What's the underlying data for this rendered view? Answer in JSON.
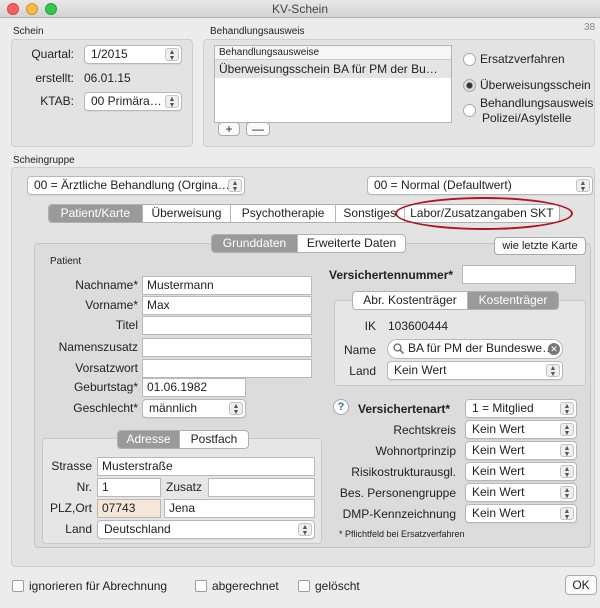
{
  "window": {
    "title": "KV-Schein"
  },
  "schein": {
    "legend": "Schein",
    "quartal_label": "Quartal:",
    "quartal_value": "1/2015",
    "erstellt_label": "erstellt:",
    "erstellt_value": "06.01.15",
    "ktab_label": "KTAB:",
    "ktab_value": "00 Primära…"
  },
  "behandlungsausweis": {
    "legend": "Behandlungsausweis",
    "list_header": "Behandlungsausweise",
    "list_item": "Überweisungsschein BA für PM der Bu…",
    "add_label": "+",
    "remove_label": "—",
    "radio_ersatz": "Ersatzverfahren",
    "radio_ueberweisung": "Überweisungsschein",
    "radio_behandlung_line1": "Behandlungsausweis",
    "radio_behandlung_line2": "Polizei/Asylstelle",
    "side_number": "38"
  },
  "scheingruppe": {
    "legend": "Scheingruppe",
    "left_select": "00 = Ärztliche Behandlung (Orgina…",
    "right_select": "00 = Normal (Defaultwert)"
  },
  "tabs": [
    {
      "label": "Patient/Karte"
    },
    {
      "label": "Überweisung"
    },
    {
      "label": "Psychotherapie"
    },
    {
      "label": "Sonstiges"
    },
    {
      "label": "Labor/Zusatzangaben SKT"
    }
  ],
  "subtabs": {
    "grunddaten": "Grunddaten",
    "erweitert": "Erweiterte Daten"
  },
  "wie_letzte_karte": "wie letzte Karte",
  "patient": {
    "legend": "Patient",
    "nachname_label": "Nachname*",
    "nachname_value": "Mustermann",
    "vorname_label": "Vorname*",
    "vorname_value": "Max",
    "titel_label": "Titel",
    "namenszusatz_label": "Namenszusatz",
    "vorsatzwort_label": "Vorsatzwort",
    "geburtstag_label": "Geburtstag*",
    "geburtstag_value": "01.06.1982",
    "geschlecht_label": "Geschlecht*",
    "geschlecht_value": "männlich"
  },
  "address": {
    "tab_adresse": "Adresse",
    "tab_postfach": "Postfach",
    "strasse_label": "Strasse",
    "strasse_value": "Musterstraße",
    "nr_label": "Nr.",
    "nr_value": "1",
    "zusatz_label": "Zusatz",
    "plz_label": "PLZ,Ort",
    "plz_value": "07743",
    "ort_value": "Jena",
    "land_label": "Land",
    "land_value": "Deutschland"
  },
  "versicherter": {
    "nummer_label": "Versichertennummer*",
    "tab_abr": "Abr. Kostenträger",
    "tab_kosten": "Kostenträger",
    "ik_label": "IK",
    "ik_value": "103600444",
    "name_label": "Name",
    "name_value": "BA für PM der Bundeswe…",
    "land_label": "Land",
    "land_value": "Kein Wert"
  },
  "versichertenart": {
    "help": "?",
    "label": "Versichertenart*",
    "value": "1 = Mitglied",
    "rows": [
      {
        "label": "Rechtskreis",
        "value": "Kein Wert"
      },
      {
        "label": "Wohnortprinzip",
        "value": "Kein Wert"
      },
      {
        "label": "Risikostrukturausgl.",
        "value": "Kein Wert"
      },
      {
        "label": "Bes. Personengruppe",
        "value": "Kein Wert"
      },
      {
        "label": "DMP-Kennzeichnung",
        "value": "Kein Wert"
      }
    ],
    "footnote": "* Pflichtfeld bei Ersatzverfahren"
  },
  "footer": {
    "ignorieren": "ignorieren für Abrechnung",
    "abgerechnet": "abgerechnet",
    "geloescht": "gelöscht",
    "ok": "OK"
  },
  "colors": {
    "highlight_ellipse": "#b0141e",
    "segment_selected": "#9a9a9a",
    "plz_highlight": "#f4e6d8"
  }
}
